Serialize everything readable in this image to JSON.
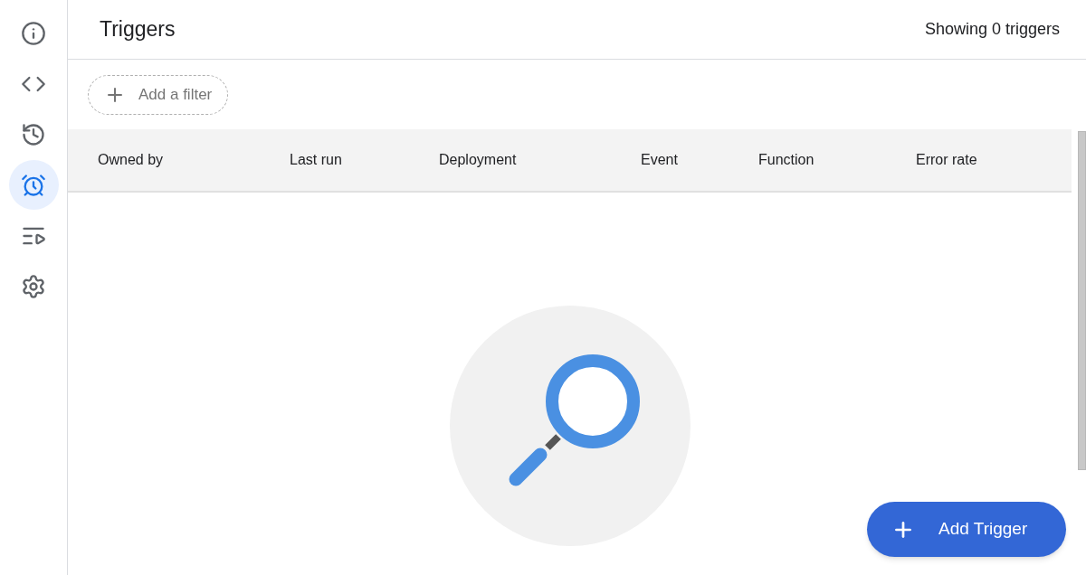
{
  "sidebar": {
    "items": [
      {
        "kind": "info",
        "selected": false
      },
      {
        "kind": "code",
        "selected": false
      },
      {
        "kind": "history",
        "selected": false
      },
      {
        "kind": "alarm",
        "selected": true
      },
      {
        "kind": "executions",
        "selected": false
      },
      {
        "kind": "settings",
        "selected": false
      }
    ]
  },
  "header": {
    "title": "Triggers",
    "count": "Showing 0 triggers"
  },
  "filter": {
    "label": "Add a filter"
  },
  "table": {
    "columns": [
      "Owned by",
      "Last run",
      "Deployment",
      "Event",
      "Function",
      "Error rate"
    ]
  },
  "fab": {
    "label": "Add Trigger"
  }
}
